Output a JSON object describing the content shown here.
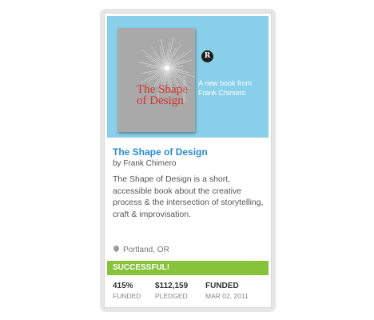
{
  "project": {
    "hero": {
      "book_title": "The Shape of Design",
      "book_spine": "Frank Chimero",
      "badge": "R",
      "tagline": "A new book from Frank Chimero"
    },
    "title": "The Shape of Design",
    "byline": "by Frank Chimero",
    "description": "The Shape of Design is a short, accessible book about the creative process & the intersection of storytelling, craft & improvisation.",
    "location": "Portland, OR",
    "status": "SUCCESSFUL!",
    "stats": [
      {
        "value": "415%",
        "label": "FUNDED"
      },
      {
        "value": "$112,159",
        "label": "PLEDGED"
      },
      {
        "value": "FUNDED",
        "label": "MAR 02, 2011"
      }
    ],
    "progress_percent": 415
  },
  "colors": {
    "hero_bg": "#88cfe9",
    "title_link": "#2a8ad1",
    "status_green": "#86c33a",
    "book_title_red": "#d7302a"
  }
}
